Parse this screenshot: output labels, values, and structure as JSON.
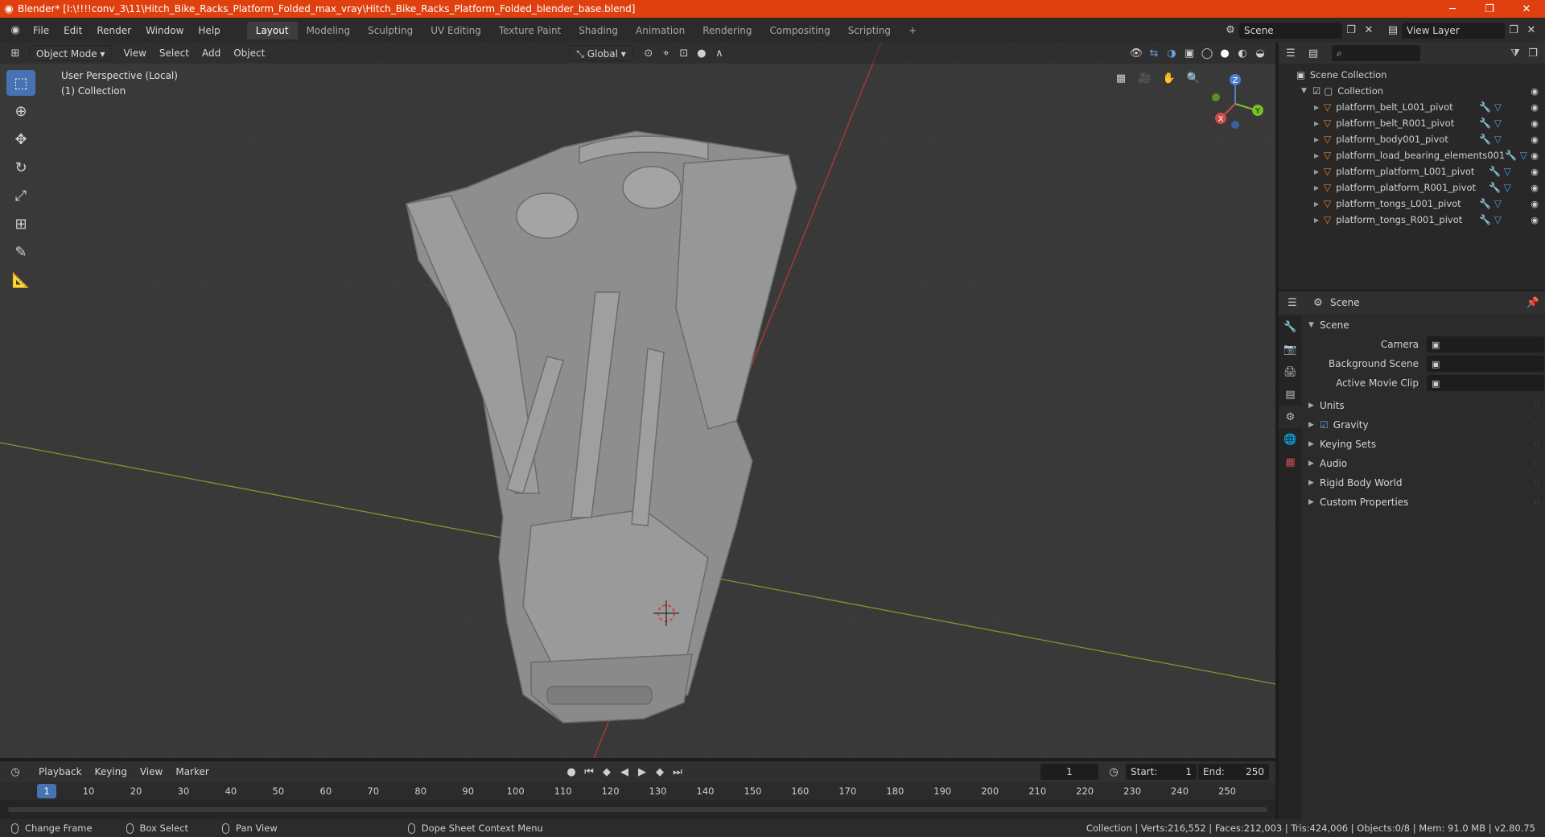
{
  "window": {
    "title": "Blender* [I:\\!!!!conv_3\\11\\Hitch_Bike_Racks_Platform_Folded_max_vray\\Hitch_Bike_Racks_Platform_Folded_blender_base.blend]",
    "minimize": "─",
    "maximize": "❐",
    "close": "✕"
  },
  "menu": [
    "File",
    "Edit",
    "Render",
    "Window",
    "Help"
  ],
  "workspaces": [
    "Layout",
    "Modeling",
    "Sculpting",
    "UV Editing",
    "Texture Paint",
    "Shading",
    "Animation",
    "Rendering",
    "Compositing",
    "Scripting"
  ],
  "workspace_add": "+",
  "scene_field": "Scene",
  "view_layer_field": "View Layer",
  "viewport": {
    "mode": "Object Mode",
    "menus": [
      "View",
      "Select",
      "Add",
      "Object"
    ],
    "transform_orientation": "Global",
    "info_line1": "User Perspective (Local)",
    "info_line2": "(1) Collection",
    "gizmo": {
      "x": "X",
      "y": "Y",
      "z": "Z"
    }
  },
  "outliner": {
    "search_placeholder": "",
    "scene_collection": "Scene Collection",
    "collection": "Collection",
    "objects": [
      "platform_belt_L001_pivot",
      "platform_belt_R001_pivot",
      "platform_body001_pivot",
      "platform_load_bearing_elements001",
      "platform_platform_L001_pivot",
      "platform_platform_R001_pivot",
      "platform_tongs_L001_pivot",
      "platform_tongs_R001_pivot"
    ]
  },
  "properties": {
    "context": "Scene",
    "section": "Scene",
    "fields": [
      {
        "label": "Camera",
        "value": ""
      },
      {
        "label": "Background Scene",
        "value": ""
      },
      {
        "label": "Active Movie Clip",
        "value": ""
      }
    ],
    "panels": [
      "Units",
      "Gravity",
      "Keying Sets",
      "Audio",
      "Rigid Body World",
      "Custom Properties"
    ]
  },
  "timeline": {
    "menus": [
      "Playback",
      "Keying",
      "View",
      "Marker"
    ],
    "current_frame": "1",
    "start_label": "Start:",
    "start": "1",
    "end_label": "End:",
    "end": "250",
    "ticks": [
      "10",
      "20",
      "30",
      "40",
      "50",
      "60",
      "70",
      "80",
      "90",
      "100",
      "110",
      "120",
      "130",
      "140",
      "150",
      "160",
      "170",
      "180",
      "190",
      "200",
      "210",
      "220",
      "230",
      "240",
      "250"
    ]
  },
  "statusbar": {
    "items": [
      "Change Frame",
      "Box Select",
      "Pan View",
      "Dope Sheet Context Menu"
    ],
    "stats": "Collection | Verts:216,552 | Faces:212,003 | Tris:424,006 | Objects:0/8 | Mem: 91.0 MB | v2.80.75"
  }
}
